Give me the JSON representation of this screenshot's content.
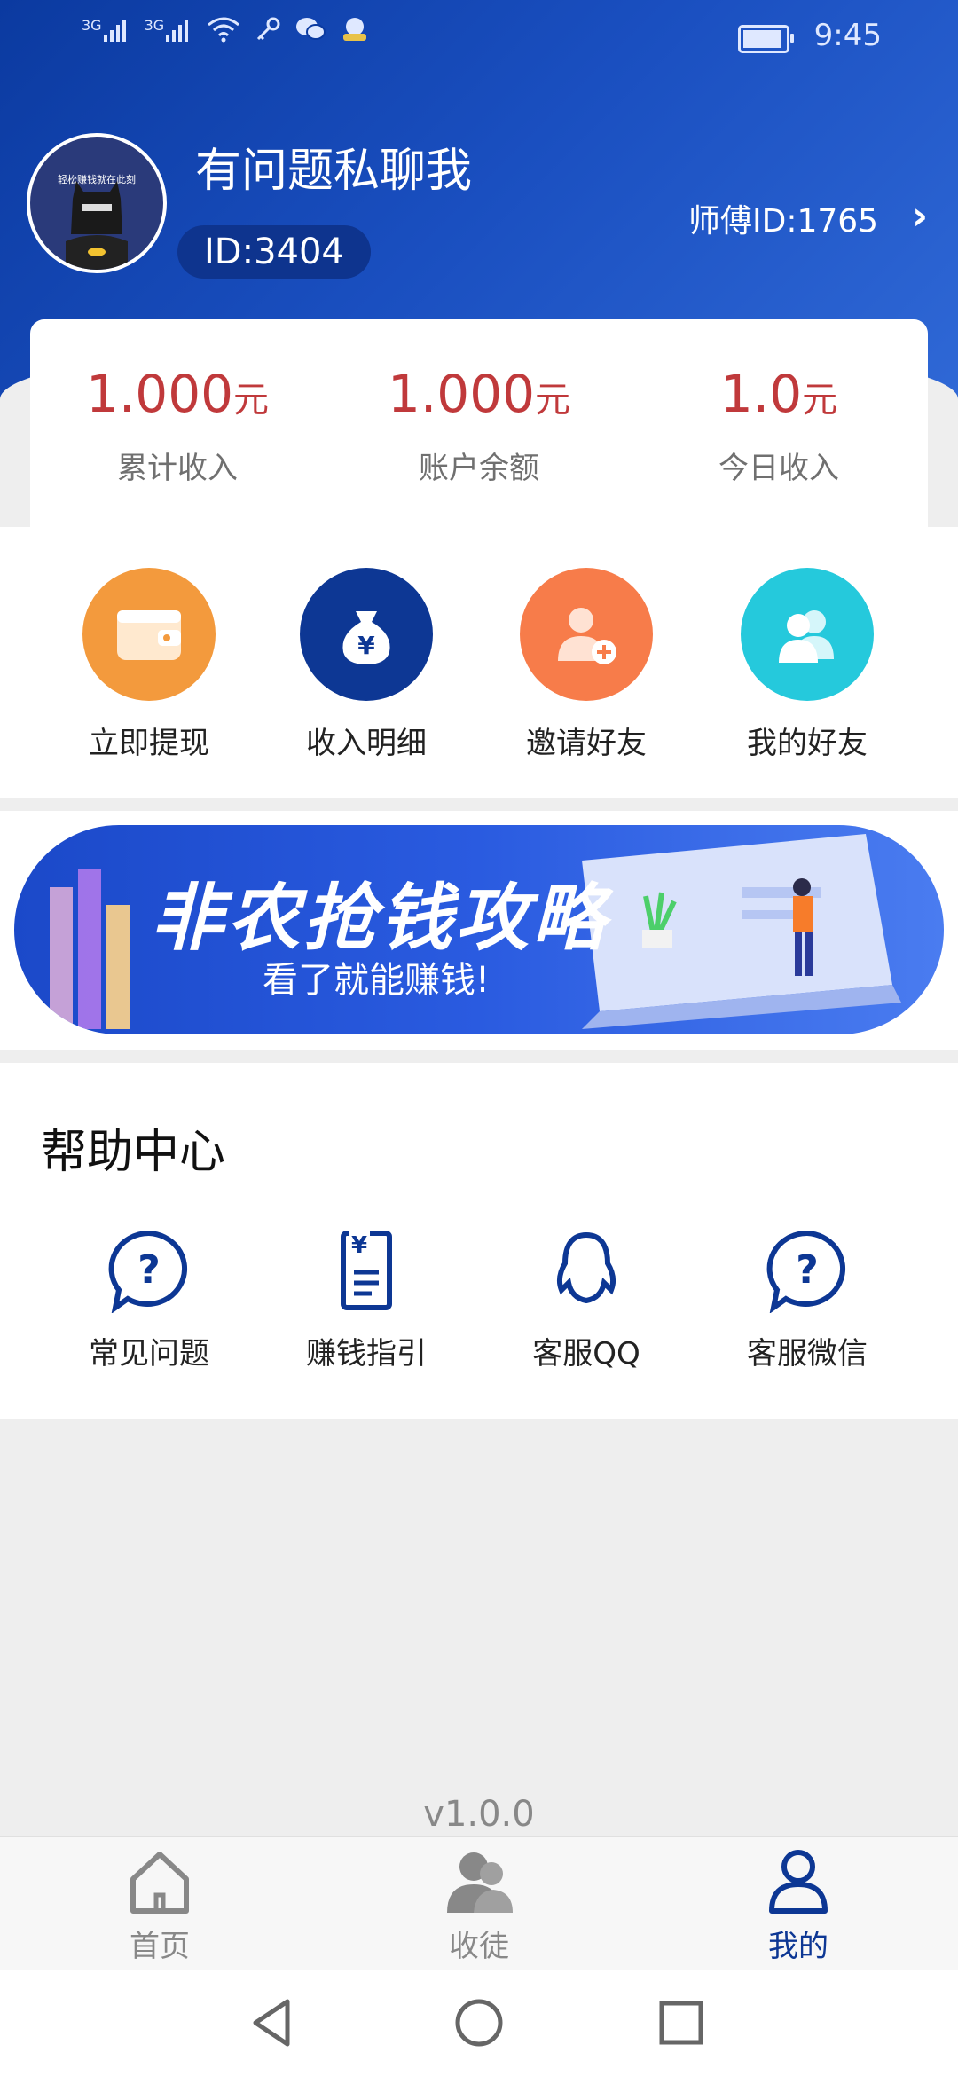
{
  "status_bar": {
    "signal_1": "3G",
    "signal_2": "3G",
    "time": "9:45",
    "icons": [
      "signal-icon",
      "signal-icon",
      "wifi-icon",
      "key-icon",
      "wechat-icon",
      "app-icon",
      "battery-icon"
    ]
  },
  "profile": {
    "avatar_caption": "轻松赚钱就在此刻",
    "username": "有问题私聊我",
    "user_id": "ID:3404",
    "master_id": "师傅ID:1765"
  },
  "stats": [
    {
      "value": "1.000",
      "unit": "元",
      "label": "累计收入"
    },
    {
      "value": "1.000",
      "unit": "元",
      "label": "账户余额"
    },
    {
      "value": "1.0",
      "unit": "元",
      "label": "今日收入"
    }
  ],
  "actions": [
    {
      "label": "立即提现",
      "icon": "wallet-icon",
      "color": "#f39a3d"
    },
    {
      "label": "收入明细",
      "icon": "money-bag-icon",
      "color": "#0d3794"
    },
    {
      "label": "邀请好友",
      "icon": "add-user-icon",
      "color": "#f77c4a"
    },
    {
      "label": "我的好友",
      "icon": "users-icon",
      "color": "#25c9dc"
    }
  ],
  "banner": {
    "title": "非农抢钱攻略",
    "subtitle": "看了就能赚钱!"
  },
  "help_center": {
    "title": "帮助中心",
    "items": [
      {
        "label": "常见问题",
        "icon": "question-chat-icon"
      },
      {
        "label": "赚钱指引",
        "icon": "document-icon"
      },
      {
        "label": "客服QQ",
        "icon": "qq-icon"
      },
      {
        "label": "客服微信",
        "icon": "question-chat-icon"
      }
    ]
  },
  "version": "v1.0.0",
  "tabbar": [
    {
      "label": "首页",
      "icon": "home-icon",
      "active": false
    },
    {
      "label": "收徒",
      "icon": "apprentice-icon",
      "active": false
    },
    {
      "label": "我的",
      "icon": "profile-icon",
      "active": true
    }
  ],
  "colors": {
    "brand_blue": "#0d3794",
    "accent_red": "#c0393b",
    "active_tab": "#0d3794",
    "inactive_tab": "#888888"
  }
}
